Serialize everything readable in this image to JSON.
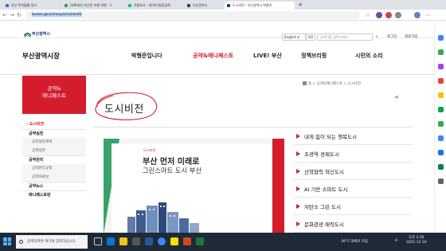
{
  "browser": {
    "tabs": [
      {
        "label": "부산 주력월별 정리",
        "color": "#2b6fd6"
      },
      {
        "label": "[UB대부] 피곤한 보험 여행 - 1",
        "color": "#3c9f3c"
      },
      {
        "label": "곡물보고 - 네이버 통합검색",
        "color": "#03c75a"
      },
      {
        "label": "부산광역시",
        "color": "#1f3b7a"
      }
    ],
    "active_tab_label": "도시비전 - 부산광역시 박형준",
    "url_highlight": "busan.go.kr/mayor/vision01"
  },
  "site": {
    "logo_text": "부산광역시",
    "language": "English",
    "go_label": "GO",
    "search_placeholder": "검색어를 입력하세요",
    "top_links": [
      "로그인",
      "회원가입"
    ],
    "title": "부산광역시장",
    "gnb": [
      "박형준입니다",
      "공약&매니페스토",
      "LIVE! 부산",
      "정책브리핑",
      "시민의 소리"
    ]
  },
  "lnb": {
    "head": [
      "공약&",
      "매니페스토"
    ],
    "items": [
      {
        "label": "도시비전",
        "kind": "on"
      },
      {
        "label": "공약실천",
        "kind": "bold"
      },
      {
        "label": "공약실천계획",
        "kind": "sub"
      },
      {
        "label": "공약실천",
        "kind": "sub"
      },
      {
        "label": "공약관리",
        "kind": "bold"
      },
      {
        "label": "공약관리규정",
        "kind": "sub"
      },
      {
        "label": "공약자료실",
        "kind": "sub"
      },
      {
        "label": "공약뉴스",
        "kind": "bold"
      },
      {
        "label": "매니페스토란",
        "kind": "bold"
      }
    ]
  },
  "content": {
    "breadcrumb": "홈 > 공약&매니페스토 > 도시비전",
    "page_title": "도시비전",
    "share_symbol": "⋖",
    "banner": {
      "small": "도시비전",
      "line1": "부산 먼저 미래로",
      "line2": "그린스마트 도시 부산"
    },
    "visions": [
      "내게 힘이 되는 행복도시",
      "초광역 경제도시",
      "산학협력 혁신도시",
      "AI 기반 스마트 도시",
      "저탄소 그린 도시",
      "문화관광 매력도시"
    ]
  },
  "taskbar": {
    "search_placeholder": "검색하려면 여기에 입력하십시오.",
    "weather": "16°C 대체로 흐림",
    "ime": "A",
    "time": "오후 3:26",
    "date": "2021-12-10"
  },
  "colors": {
    "accent": "#d31d2c",
    "green": "#37a36a",
    "navy": "#1f3b7a"
  }
}
